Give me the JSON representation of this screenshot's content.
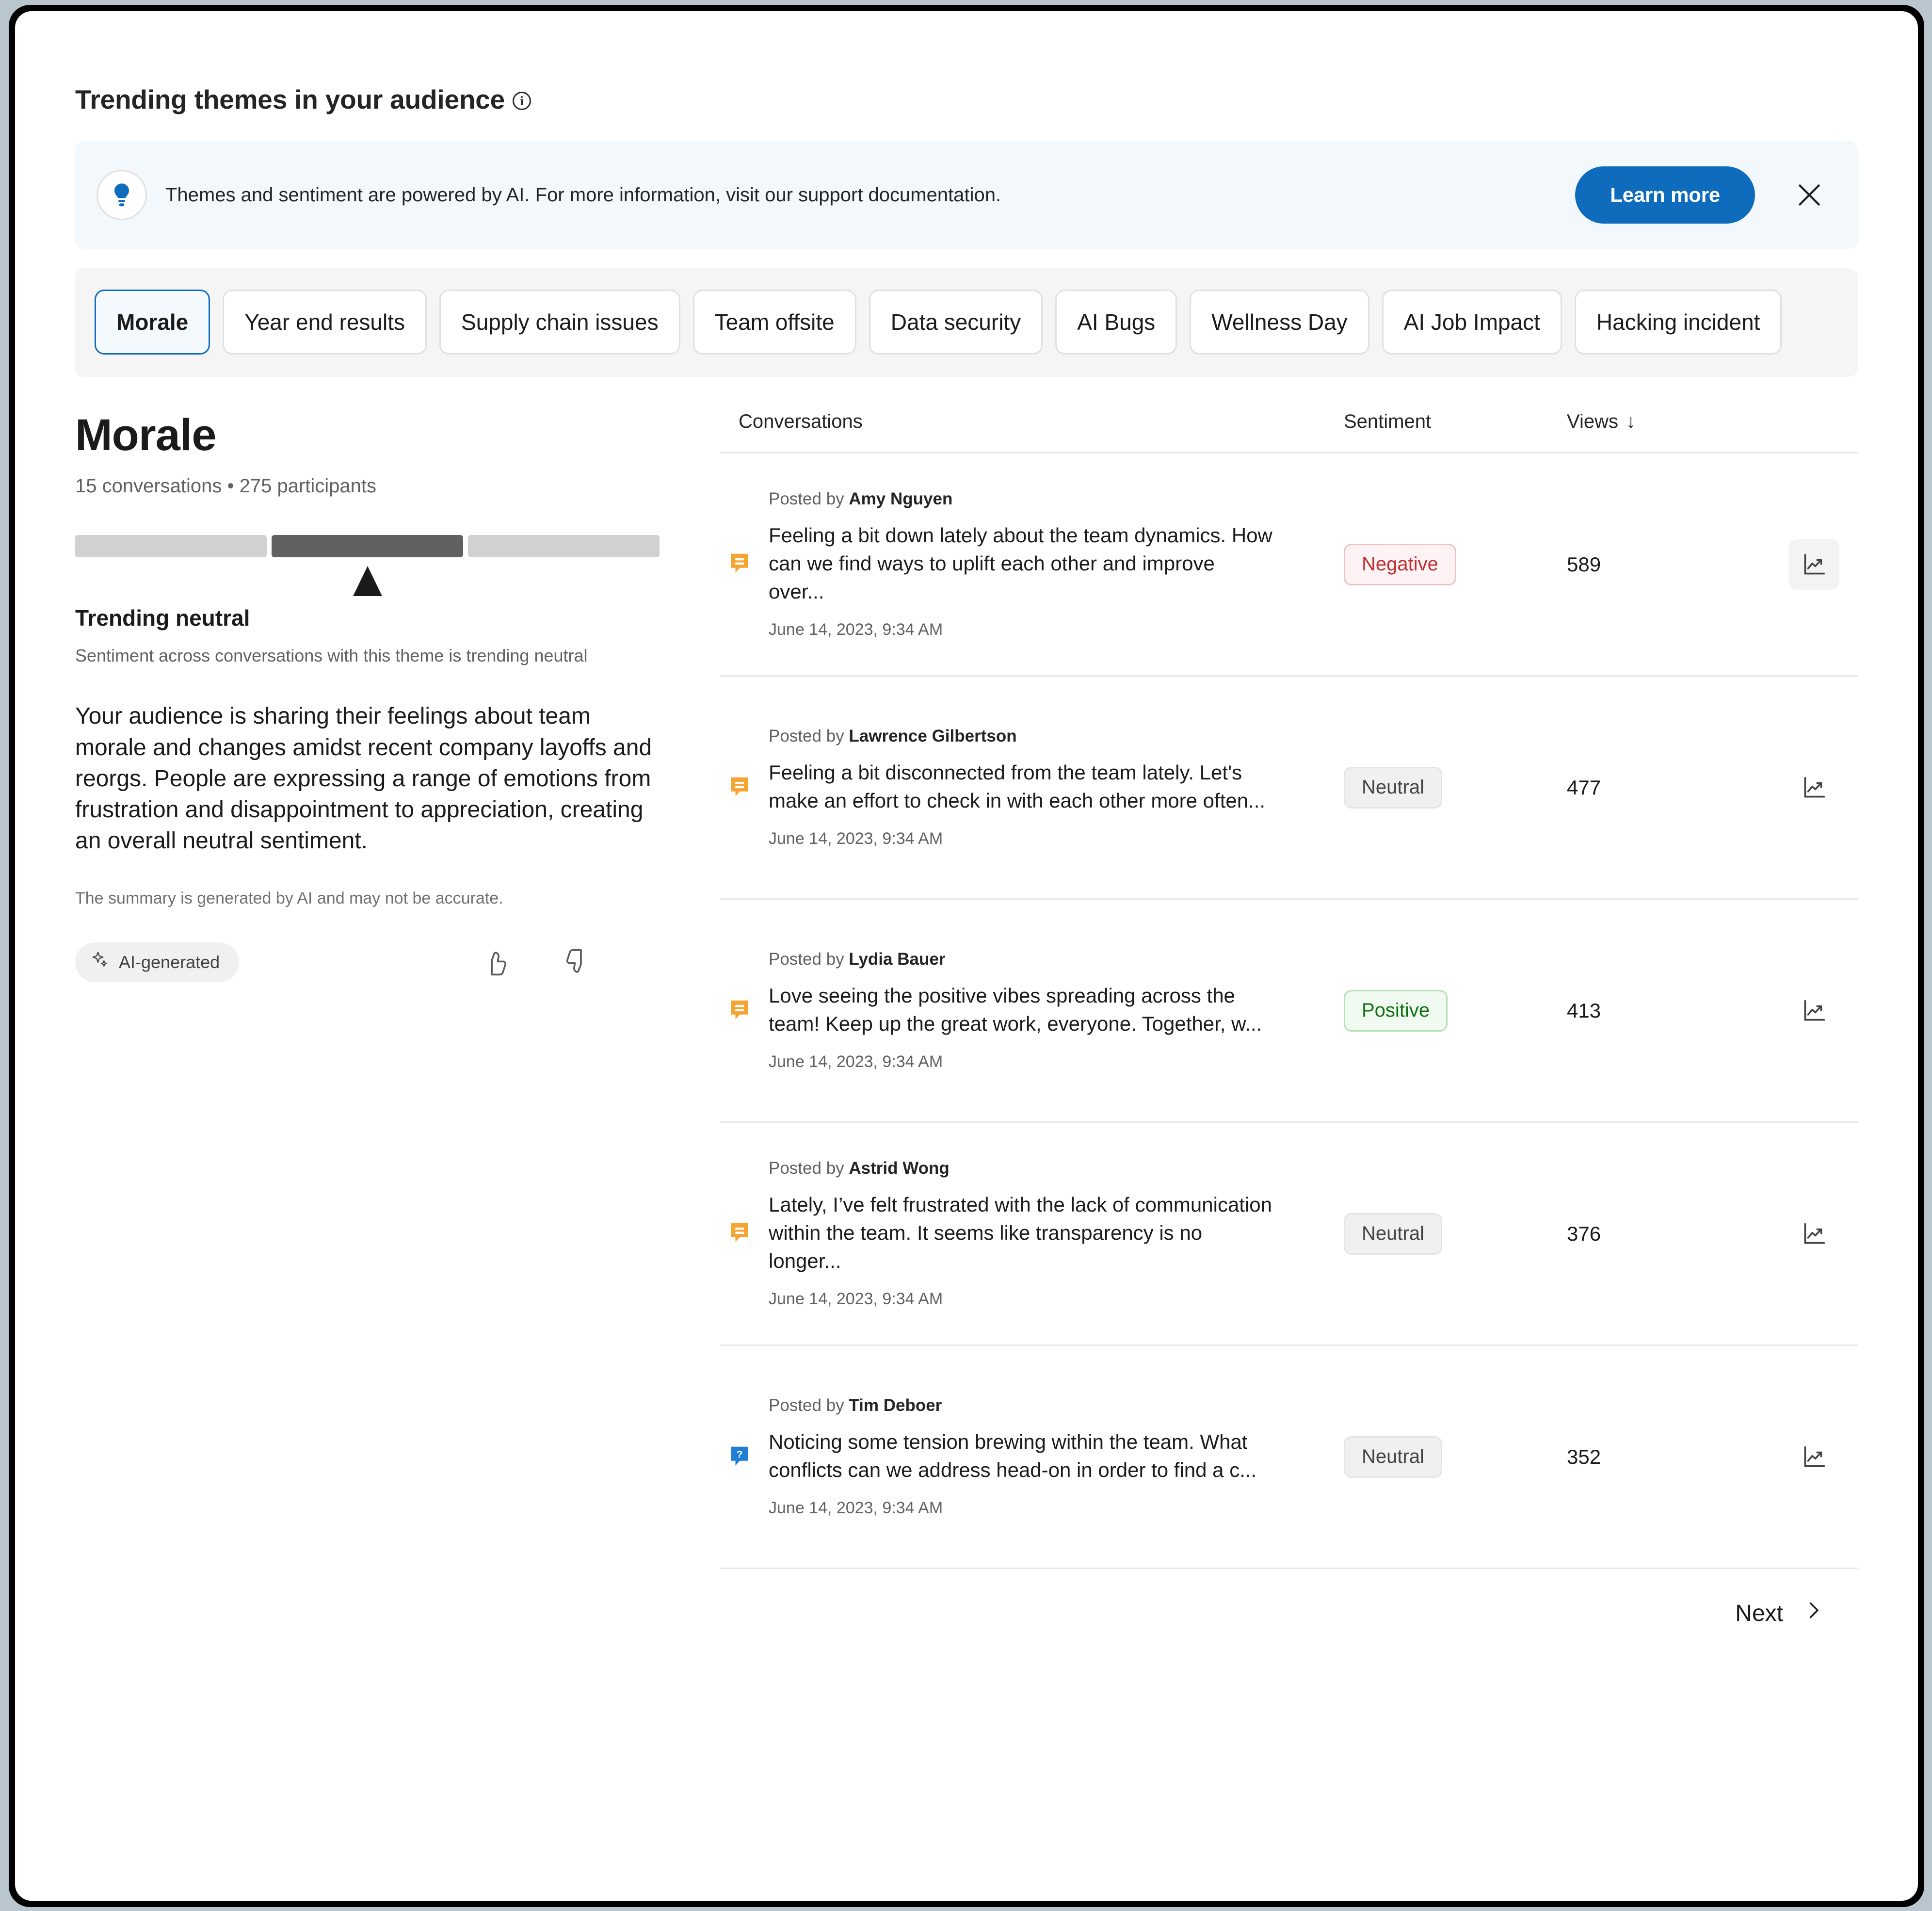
{
  "page": {
    "title": "Trending themes in your audience",
    "info_icon_label": "i"
  },
  "banner": {
    "icon": "lightbulb-icon",
    "message": "Themes and sentiment are powered by AI. For more information, visit our support documentation.",
    "cta_label": "Learn more",
    "close_label": "close-icon",
    "accent_color": "#0f6cbd",
    "background_color": "#f3f8fc"
  },
  "themes": {
    "selected": "Morale",
    "chips": [
      {
        "label": "Morale",
        "selected": true
      },
      {
        "label": "Year end results",
        "selected": false
      },
      {
        "label": "Supply chain issues",
        "selected": false
      },
      {
        "label": "Team offsite",
        "selected": false
      },
      {
        "label": "Data security",
        "selected": false
      },
      {
        "label": "AI Bugs",
        "selected": false
      },
      {
        "label": "Wellness Day",
        "selected": false
      },
      {
        "label": "AI Job Impact",
        "selected": false
      },
      {
        "label": "Hacking incident",
        "selected": false
      }
    ]
  },
  "detail": {
    "theme_name": "Morale",
    "meta": "15 conversations  •  275 participants",
    "conversation_count": 15,
    "participant_count": 275,
    "sentiment_meter": {
      "segments": [
        "negative",
        "neutral",
        "positive"
      ],
      "active_index": 1,
      "active_color": "#616161",
      "inactive_color": "#d1d1d1"
    },
    "trend_title": "Trending neutral",
    "trend_subtitle": "Sentiment across conversations with this theme is trending neutral",
    "summary": "Your audience is sharing their feelings about team morale and changes amidst recent company layoffs and reorgs. People are expressing a range of emotions from frustration and disappointment to appreciation, creating an overall neutral sentiment.",
    "disclaimer": "The summary is generated by AI and may not be accurate.",
    "ai_badge_label": "AI-generated",
    "thumbs_up_label": "thumbs-up-icon",
    "thumbs_down_label": "thumbs-down-icon"
  },
  "table": {
    "columns": {
      "conversations": "Conversations",
      "sentiment": "Sentiment",
      "views": "Views",
      "sort_direction": "↓"
    },
    "rows": [
      {
        "icon": "discussion-icon",
        "icon_color": "#f7a331",
        "posted_prefix": "Posted by",
        "author": "Amy Nguyen",
        "snippet": "Feeling a bit down lately about the team dynamics. How can we find ways to uplift each other and improve over...",
        "timestamp": "June 14, 2023, 9:34 AM",
        "sentiment": "Negative",
        "sentiment_kind": "negative",
        "views": "589",
        "action_icon": "trend-chart-icon",
        "action_active": true
      },
      {
        "icon": "discussion-icon",
        "icon_color": "#f7a331",
        "posted_prefix": "Posted by",
        "author": "Lawrence Gilbertson",
        "snippet": "Feeling a bit disconnected from the team lately. Let's make an effort to check in with each other more often...",
        "timestamp": "June 14, 2023, 9:34 AM",
        "sentiment": "Neutral",
        "sentiment_kind": "neutral",
        "views": "477",
        "action_icon": "trend-chart-icon",
        "action_active": false
      },
      {
        "icon": "discussion-icon",
        "icon_color": "#f7a331",
        "posted_prefix": "Posted by",
        "author": "Lydia Bauer",
        "snippet": "Love seeing the positive vibes spreading across the team! Keep up the great work, everyone. Together, w...",
        "timestamp": "June 14, 2023, 9:34 AM",
        "sentiment": "Positive",
        "sentiment_kind": "positive",
        "views": "413",
        "action_icon": "trend-chart-icon",
        "action_active": false
      },
      {
        "icon": "discussion-icon",
        "icon_color": "#f7a331",
        "posted_prefix": "Posted by",
        "author": "Astrid Wong",
        "snippet": "Lately, I’ve felt frustrated with the lack of communication within the team. It seems like transparency is no longer...",
        "timestamp": "June 14, 2023, 9:34 AM",
        "sentiment": "Neutral",
        "sentiment_kind": "neutral",
        "views": "376",
        "action_icon": "trend-chart-icon",
        "action_active": false
      },
      {
        "icon": "question-icon",
        "icon_color": "#1f7fd4",
        "posted_prefix": "Posted by",
        "author": "Tim Deboer",
        "snippet": "Noticing some tension brewing within the team. What conflicts can we address head-on in order to find a c...",
        "timestamp": "June 14, 2023, 9:34 AM",
        "sentiment": "Neutral",
        "sentiment_kind": "neutral",
        "views": "352",
        "action_icon": "trend-chart-icon",
        "action_active": false
      }
    ],
    "next_label": "Next"
  }
}
